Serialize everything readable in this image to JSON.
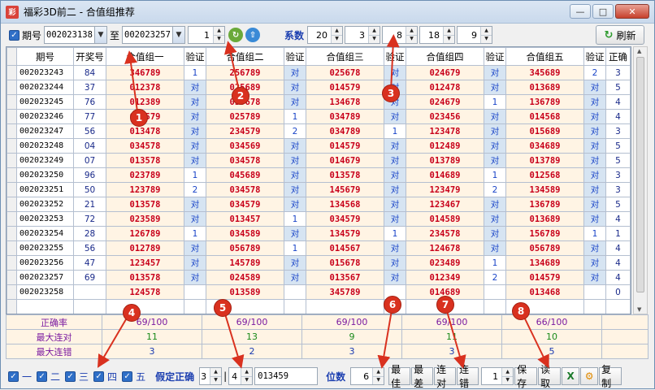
{
  "window": {
    "title": "福彩3D前二 - 合值组推荐",
    "icon_glyph": "彩"
  },
  "toolbar": {
    "period_label": "期号",
    "from_period": "002023138",
    "to_label": "至",
    "to_period": "002023257",
    "step_value": "1",
    "coeff_label": "系数",
    "coeff_values": [
      "20",
      "3",
      "8",
      "18",
      "9"
    ],
    "refresh_label": "刷新"
  },
  "grid": {
    "headers": [
      "期号",
      "开奖号",
      "合值组一",
      "验证",
      "合值组二",
      "验证",
      "合值组三",
      "验证",
      "合值组四",
      "验证",
      "合值组五",
      "验证",
      "正确"
    ],
    "rows": [
      [
        "002023243",
        "84",
        "346789",
        "1",
        "256789",
        "对",
        "025678",
        "对",
        "024679",
        "对",
        "345689",
        "2",
        "3"
      ],
      [
        "002023244",
        "37",
        "012378",
        "对",
        "025689",
        "对",
        "014579",
        "对",
        "012478",
        "对",
        "013689",
        "对",
        "5"
      ],
      [
        "002023245",
        "76",
        "012389",
        "对",
        "035678",
        "对",
        "134678",
        "对",
        "024679",
        "1",
        "136789",
        "对",
        "4"
      ],
      [
        "002023246",
        "77",
        "034579",
        "对",
        "025789",
        "1",
        "034789",
        "对",
        "023456",
        "对",
        "014568",
        "对",
        "4"
      ],
      [
        "002023247",
        "56",
        "013478",
        "对",
        "234579",
        "2",
        "034789",
        "1",
        "123478",
        "对",
        "015689",
        "对",
        "3"
      ],
      [
        "002023248",
        "04",
        "034578",
        "对",
        "034569",
        "对",
        "014579",
        "对",
        "012489",
        "对",
        "034689",
        "对",
        "5"
      ],
      [
        "002023249",
        "07",
        "013578",
        "对",
        "034578",
        "对",
        "014679",
        "对",
        "013789",
        "对",
        "013789",
        "对",
        "5"
      ],
      [
        "002023250",
        "96",
        "023789",
        "1",
        "045689",
        "对",
        "013578",
        "对",
        "014689",
        "1",
        "012568",
        "对",
        "3"
      ],
      [
        "002023251",
        "50",
        "123789",
        "2",
        "034578",
        "对",
        "145679",
        "对",
        "123479",
        "2",
        "134589",
        "对",
        "3"
      ],
      [
        "002023252",
        "21",
        "013578",
        "对",
        "034579",
        "对",
        "134568",
        "对",
        "123467",
        "对",
        "136789",
        "对",
        "5"
      ],
      [
        "002023253",
        "72",
        "023589",
        "对",
        "013457",
        "1",
        "034579",
        "对",
        "014589",
        "对",
        "013689",
        "对",
        "4"
      ],
      [
        "002023254",
        "28",
        "126789",
        "1",
        "034589",
        "对",
        "134579",
        "1",
        "234578",
        "对",
        "156789",
        "1",
        "1"
      ],
      [
        "002023255",
        "56",
        "012789",
        "对",
        "056789",
        "1",
        "014567",
        "对",
        "124678",
        "对",
        "056789",
        "对",
        "4"
      ],
      [
        "002023256",
        "47",
        "123457",
        "对",
        "145789",
        "对",
        "015678",
        "对",
        "023489",
        "1",
        "134689",
        "对",
        "4"
      ],
      [
        "002023257",
        "69",
        "013578",
        "对",
        "024589",
        "对",
        "013567",
        "对",
        "012349",
        "2",
        "014579",
        "对",
        "4"
      ],
      [
        "002023258",
        "",
        "124578",
        "",
        "013589",
        "",
        "345789",
        "",
        "014689",
        "",
        "013468",
        "",
        "0"
      ]
    ]
  },
  "stats": {
    "rate_label": "正确率",
    "max_hit_label": "最大连对",
    "max_miss_label": "最大连错",
    "rates": [
      "69/100",
      "69/100",
      "69/100",
      "69/100",
      "66/100"
    ],
    "max_hits": [
      "11",
      "13",
      "9",
      "11",
      "10"
    ],
    "max_misses": [
      "3",
      "2",
      "3",
      "3",
      "5"
    ]
  },
  "bottom": {
    "group_checks": [
      "一",
      "二",
      "三",
      "四",
      "五"
    ],
    "assume_label": "假定正确",
    "assume_value": "3",
    "assume_value2": "4",
    "custom_digits": "013459",
    "digits_label": "位数",
    "digits_value": "6",
    "best_label": "最佳",
    "worst_label": "最差",
    "streak_hit_label": "连对",
    "streak_miss_label": "连错",
    "save_slot": "1",
    "save_label": "保存",
    "read_label": "读取",
    "copy_label": "复制"
  },
  "annotations": [
    "1",
    "2",
    "3",
    "4",
    "5",
    "6",
    "7",
    "8"
  ],
  "colors": {
    "accent_red": "#c8001a",
    "hit_blue": "#1a45c8",
    "marker_red": "#d9311f",
    "cell_bg": "#fff4e4"
  }
}
